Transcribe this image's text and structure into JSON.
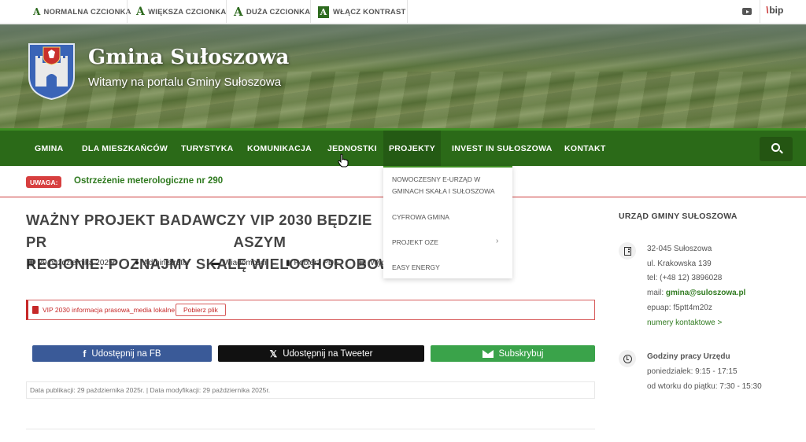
{
  "accessibility": {
    "normal_font": "NORMALNA CZCIONKA",
    "larger_font": "WIĘKSZA CZCIONKA",
    "large_font": "DUŻA CZCIONKA",
    "contrast": "WŁĄCZ KONTRAST",
    "letter": "A",
    "icons": [
      "youtube-icon",
      "bip-icon"
    ],
    "bip_label": "bip"
  },
  "header": {
    "title": "Gmina Sułoszowa",
    "subtitle": "Witamy na portalu Gminy Sułoszowa"
  },
  "nav": {
    "items": [
      "GMINA",
      "DLA MIESZKAŃCÓW",
      "TURYSTYKA",
      "KOMUNIKACJA",
      "JEDNOSTKI",
      "PROJEKTY",
      "INVEST IN SUŁOSZOWA",
      "KONTAKT"
    ],
    "active": "PROJEKTY",
    "dropdown": [
      "NOWOCZESNY E-URZĄD W GMINACH SKAŁA I SUŁOSZOWA",
      "CYFROWA GMINA",
      "PROJEKT OZE",
      "EASY ENERGY"
    ]
  },
  "alert": {
    "badge": "UWAGA:",
    "text": "Ostrzeżenie meterologiczne nr 290"
  },
  "article": {
    "title_line1": "WAŻNY PROJEKT BADAWCZY VIP 2030 BĘDZIE PR",
    "title_line1_end": "ASZYM",
    "title_line2": "REGIONIE. POZNAJMY SKALĘ WIELOCHOROBOWO",
    "date": "29 października 2025r.",
    "author": "Administrator",
    "category": "Wiadomości",
    "pdf": "Pobierz PDF",
    "print": "Wyd",
    "attachment_name": "VIP 2030 informacja prasowa_media lokalne",
    "attachment_button": "Pobierz plik",
    "share_fb": "Udostępnij na FB",
    "share_tw": "Udostępnij na Tweeter",
    "subscribe": "Subskrybuj",
    "pub_info": "Data publikacji: 29 października 2025r. | Data modyfikacji: 29 października 2025r."
  },
  "sidebar": {
    "title": "URZĄD GMINY SUŁOSZOWA",
    "address1": "32-045 Sułoszowa",
    "address2": "ul. Krakowska 139",
    "tel": "tel: (+48 12) 3896028",
    "mail_label": "mail: ",
    "mail": "gmina@suloszowa.pl",
    "epuap": "epuap: f5ptt4m20z",
    "contacts_link": "numery kontaktowe >",
    "hours_title": "Godziny pracy Urzędu",
    "hours1": "poniedziałek: 9:15 - 17:15",
    "hours2": "od wtorku do piątku: 7:30 - 15:30"
  }
}
